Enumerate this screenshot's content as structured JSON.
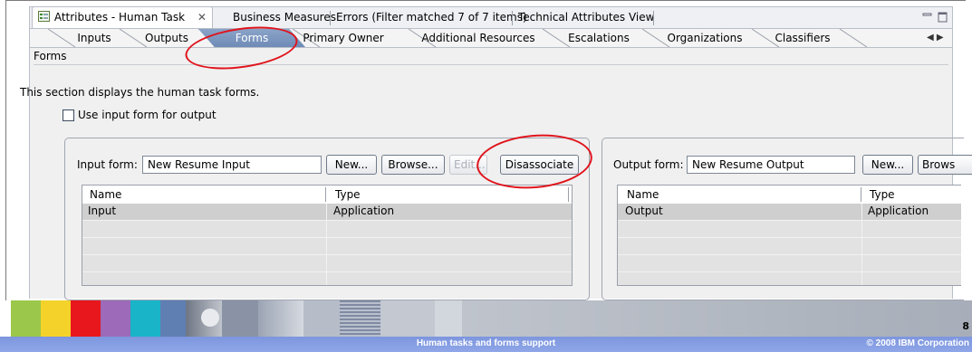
{
  "view_tabs": {
    "active_label": "Attributes - Human Task",
    "close_glyph": "✕",
    "tabs": [
      "Business Measures",
      "Errors (Filter matched 7 of 7 items)",
      "Technical Attributes View"
    ],
    "window_controls": [
      "minimize-icon",
      "maximize-icon"
    ]
  },
  "sub_tabs": [
    "Inputs",
    "Outputs",
    "Forms",
    "Primary Owner",
    "Additional Resources",
    "Escalations",
    "Organizations",
    "Classifiers"
  ],
  "sub_tabs_active": "Forms",
  "sub_tabs_scroll": "◀ ▶",
  "section": {
    "title": "Forms",
    "description": "This section displays the human task forms.",
    "checkbox_label": "Use input form for output"
  },
  "input_group": {
    "label": "Input form:",
    "value": "New Resume Input",
    "buttons": {
      "new": "New...",
      "browse": "Browse...",
      "edit": "Edit...",
      "disassociate": "Disassociate"
    },
    "columns": [
      "Name",
      "Type"
    ],
    "rows": [
      [
        "Input",
        "Application"
      ]
    ]
  },
  "output_group": {
    "label": "Output form:",
    "value": "New Resume Output",
    "buttons": {
      "new": "New...",
      "browse": "Brows"
    },
    "columns": [
      "Name",
      "Type"
    ],
    "rows": [
      [
        "Output",
        "Application"
      ]
    ]
  },
  "footer": {
    "page_number": "8",
    "title": "Human tasks and forms support",
    "copyright": "© 2008 IBM Corporation"
  },
  "colors": {
    "annotation_red": "#e0141c",
    "active_tab": "#7890b8",
    "footer_bar": "#8aa2e4"
  }
}
